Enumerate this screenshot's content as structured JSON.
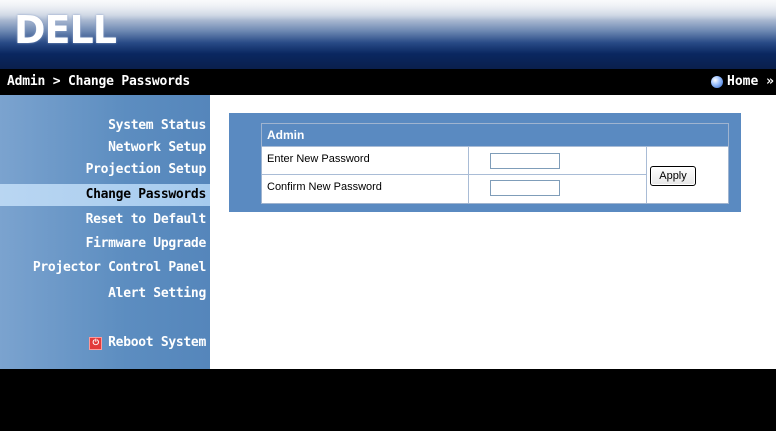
{
  "header": {
    "logo_text": "DELL",
    "breadcrumb": "Admin > Change Passwords",
    "home_label": "Home »",
    "home_icon": "globe-icon"
  },
  "sidebar": {
    "items": [
      {
        "label": "System Status"
      },
      {
        "label": "Network Setup"
      },
      {
        "label": "Projection Setup"
      },
      {
        "label": "Change Passwords",
        "active": true
      },
      {
        "label": "Reset to Default"
      },
      {
        "label": "Firmware Upgrade"
      },
      {
        "label": "Projector Control Panel"
      },
      {
        "label": "Alert Setting"
      }
    ],
    "reboot": {
      "label": "Reboot System",
      "icon": "power-icon"
    }
  },
  "panel": {
    "title": "Admin",
    "new_password_label": "Enter New Password",
    "new_password_value": "",
    "confirm_password_label": "Confirm New Password",
    "confirm_password_value": "",
    "apply_label": "Apply"
  },
  "colors": {
    "sidebar_blue": "#5c8dc0",
    "active_item": "#b9d6f2",
    "panel_blue": "#5a8ac1",
    "bar_black": "#000000"
  }
}
